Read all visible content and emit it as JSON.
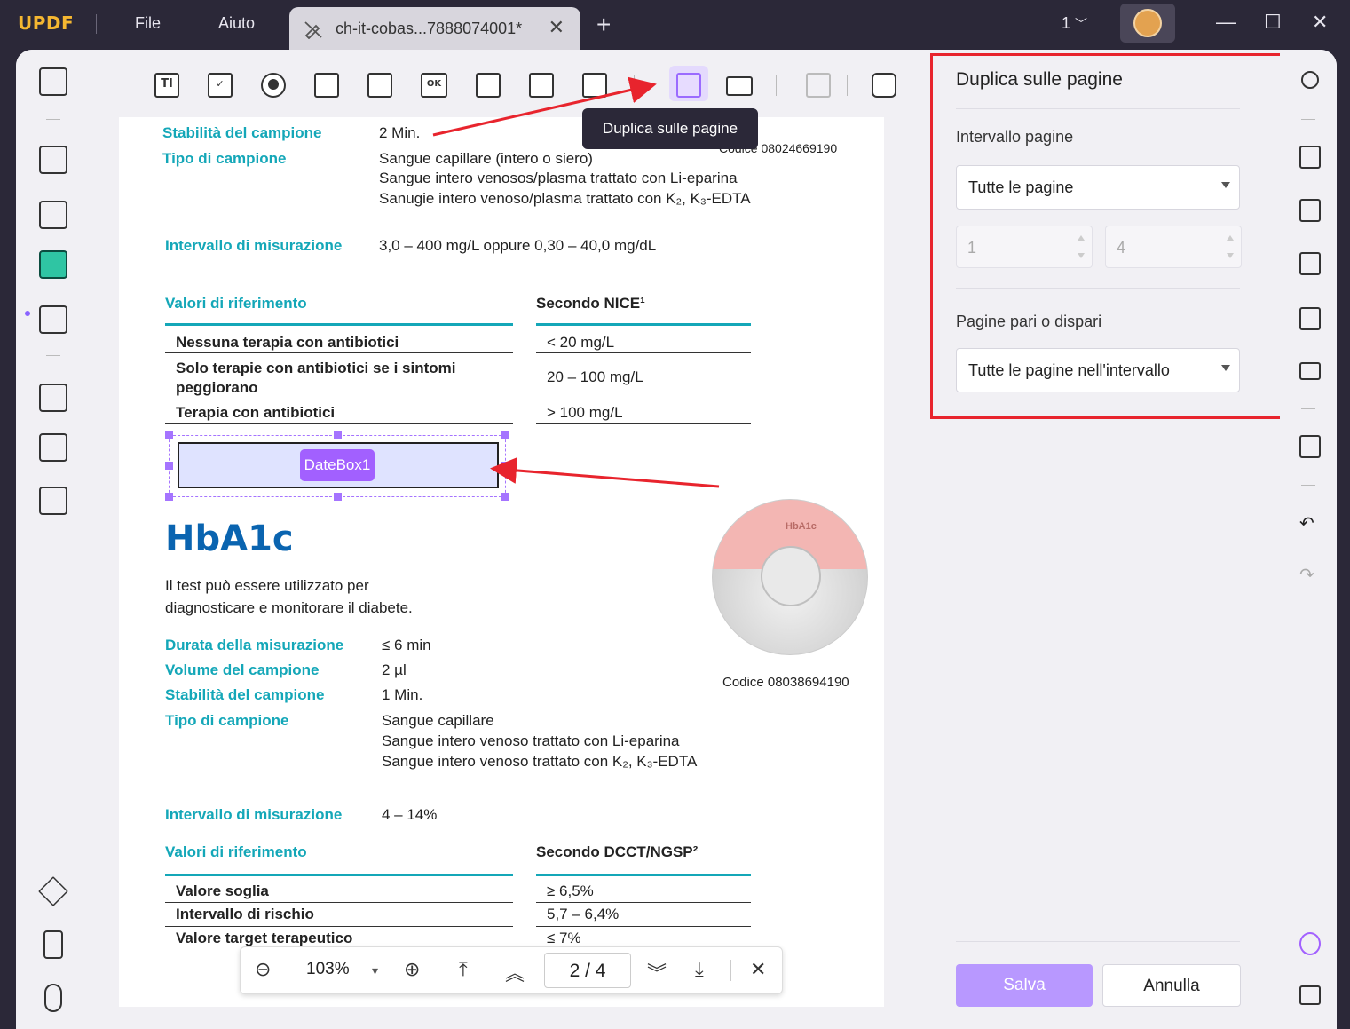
{
  "app": {
    "logo": "UPDF",
    "menu": [
      "File",
      "Aiuto"
    ],
    "tab_title": "ch-it-cobas...7888074001*",
    "tab_close": "✕",
    "new_tab": "+",
    "page_indicator": "1",
    "window_controls": [
      "—",
      "☐",
      "✕"
    ]
  },
  "toolbar": {
    "tools": [
      "text-field",
      "checkbox",
      "radio-button",
      "combo-box",
      "list-box",
      "button",
      "image-field",
      "date-field",
      "signature-field",
      "duplicate-across-pages",
      "arrange",
      "align",
      "tools"
    ],
    "tool_labels": {
      "text_field": "TI",
      "button": "OK"
    },
    "tooltip": "Duplica sulle pagine"
  },
  "document": {
    "row1": {
      "label": "Stabilità del campione",
      "value": "2 Min."
    },
    "row2": {
      "label": "Tipo di campione",
      "values": [
        "Sangue capillare (intero o siero)",
        "Sangue intero venosos/plasma trattato con Li-eparina",
        "Sanugie intero venoso/plasma trattato con K₂, K₃-EDTA"
      ]
    },
    "code1": "Codice  08024669190",
    "range1": {
      "label": "Intervallo di misurazione",
      "value": "3,0 – 400 mg/L oppure 0,30 – 40,0 mg/dL"
    },
    "ref1": {
      "label": "Valori di riferimento",
      "header": "Secondo NICE¹",
      "rows": [
        {
          "name": "Nessuna terapia con antibiotici",
          "value": "< 20 mg/L"
        },
        {
          "name": "Solo terapie con antibiotici se i sintomi peggiorano",
          "value": "20 – 100 mg/L"
        },
        {
          "name": "Terapia con antibiotici",
          "value": "> 100 mg/L"
        }
      ]
    },
    "field_label": "DateBox1",
    "hba1c_title": "HbA1c",
    "hba1c_desc": [
      "Il test può essere utilizzato per",
      "diagnosticare e monitorare il diabete."
    ],
    "product_label": "HbA1c",
    "code2": "Codice  08038694190",
    "specs": [
      {
        "label": "Durata della misurazione",
        "value": "≤ 6 min"
      },
      {
        "label": "Volume del campione",
        "value": "2 µl"
      },
      {
        "label": "Stabilità del campione",
        "value": "1 Min."
      },
      {
        "label": "Tipo di campione",
        "value": "Sangue capillare"
      }
    ],
    "sample_extra": [
      "Sangue intero venoso trattato con Li-eparina",
      "Sangue intero venoso trattato con K₂, K₃-EDTA"
    ],
    "range2": {
      "label": "Intervallo di misurazione",
      "value": "4 – 14%"
    },
    "ref2": {
      "label": "Valori di riferimento",
      "header": "Secondo DCCT/NGSP²",
      "rows": [
        {
          "name": "Valore soglia",
          "value": "≥ 6,5%"
        },
        {
          "name": "Intervallo di rischio",
          "value": "5,7 – 6,4%"
        },
        {
          "name": "Valore target terapeutico",
          "value": "≤ 7%"
        }
      ]
    }
  },
  "navbar": {
    "zoom_out": "⊖",
    "zoom": "103%",
    "zoom_caret": "▾",
    "zoom_in": "⊕",
    "first": "⤒",
    "prev": "︽",
    "page_value": "2  /  4",
    "next": "︾",
    "last": "⤓",
    "close": "✕"
  },
  "panel": {
    "title": "Duplica sulle pagine",
    "range_label": "Intervallo pagine",
    "range_value": "Tutte le pagine",
    "from_placeholder": "1",
    "to_placeholder": "4",
    "parity_label": "Pagine pari o dispari",
    "parity_value": "Tutte le pagine nell'intervallo",
    "save": "Salva",
    "cancel": "Annulla"
  },
  "colors": {
    "accent": "#a260ff",
    "teal": "#14a7b8",
    "annotation_red": "#e8242d",
    "title_blue": "#0a64b0"
  }
}
